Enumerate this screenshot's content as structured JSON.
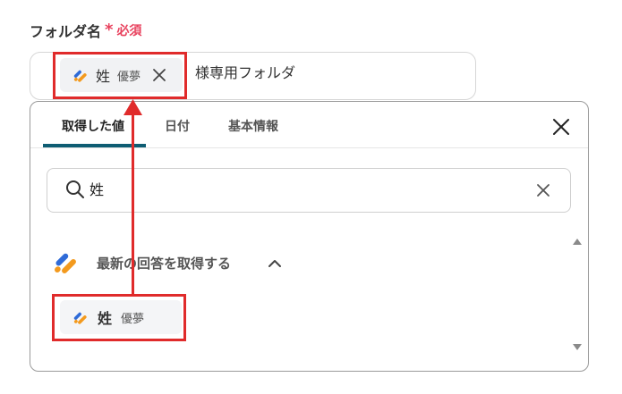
{
  "field": {
    "label": "フォルダ名",
    "required_mark": "*",
    "required_text": "必須"
  },
  "input": {
    "chip": {
      "name": "姓",
      "source": "優夢"
    },
    "suffix": "様専用フォルダ"
  },
  "panel": {
    "tabs": [
      {
        "label": "取得した値",
        "active": true
      },
      {
        "label": "日付",
        "active": false
      },
      {
        "label": "基本情報",
        "active": false
      }
    ],
    "search": {
      "value": "姓"
    },
    "section": {
      "title": "最新の回答を取得する",
      "expanded": true
    },
    "result": {
      "name": "姓",
      "source": "優夢"
    }
  },
  "colors": {
    "accent_tab": "#0e5d73",
    "required": "#e8425e",
    "annotation": "#e02b2b",
    "logo_blue": "#2f6bd8",
    "logo_orange": "#f39a1e"
  },
  "icons": [
    "app-logo-icon",
    "close-icon",
    "search-icon",
    "clear-icon",
    "chevron-up-icon",
    "scroll-up-icon",
    "scroll-down-icon"
  ]
}
